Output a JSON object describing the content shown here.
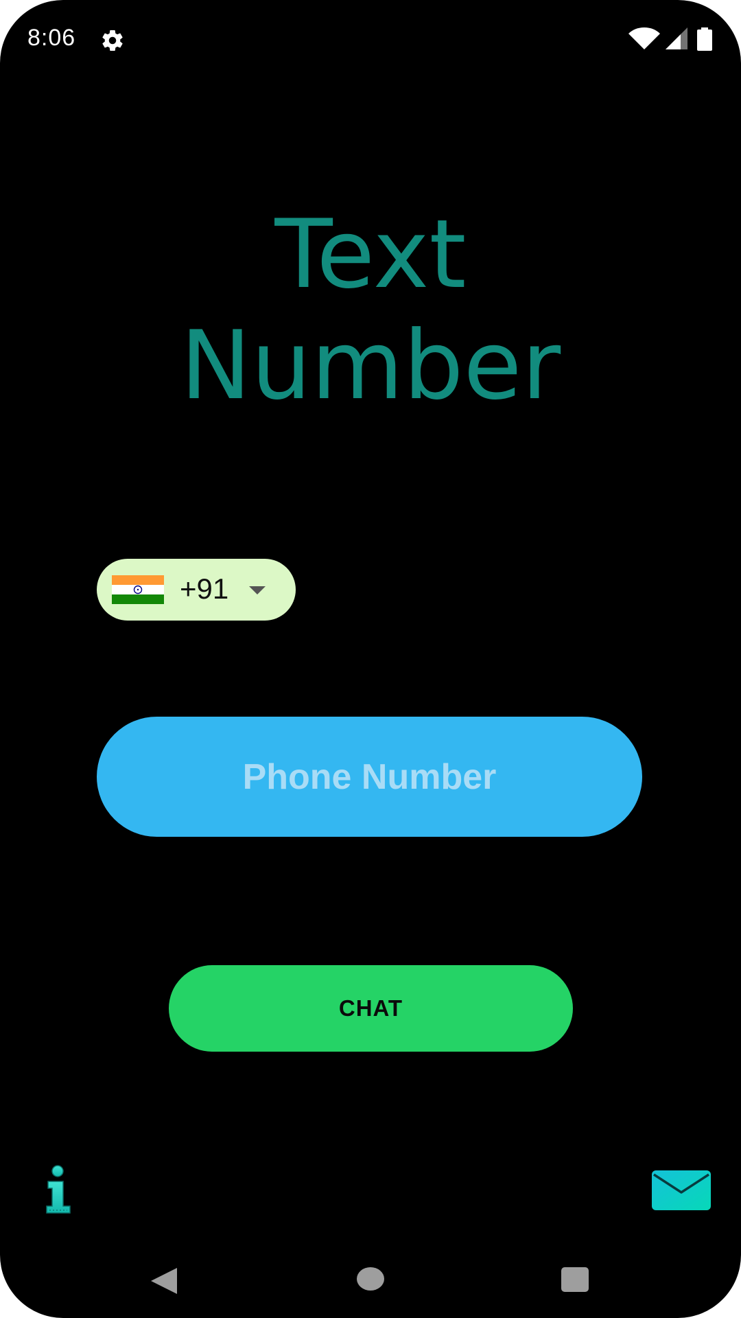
{
  "status_bar": {
    "time": "8:06",
    "icons": [
      "gear-icon",
      "wifi-icon",
      "signal-icon",
      "battery-icon"
    ]
  },
  "title": {
    "line1": "Text",
    "line2": "Number"
  },
  "country_picker": {
    "flag": "india-flag-icon",
    "code": "+91"
  },
  "phone_input": {
    "placeholder": "Phone Number",
    "value": ""
  },
  "chat_button": {
    "label": "CHAT"
  },
  "bottom_actions": {
    "left_icon": "info-icon",
    "right_icon": "mail-icon"
  },
  "nav_bar": {
    "icons": [
      "back-icon",
      "home-icon",
      "recents-icon"
    ]
  },
  "colors": {
    "background": "#000000",
    "title": "#128c7e",
    "chip_background": "#dcf8c6",
    "input_background": "#34b7f1",
    "input_placeholder": "#a9dcf6",
    "button_background": "#25d366",
    "icon_teal": "#1fd6c7"
  }
}
